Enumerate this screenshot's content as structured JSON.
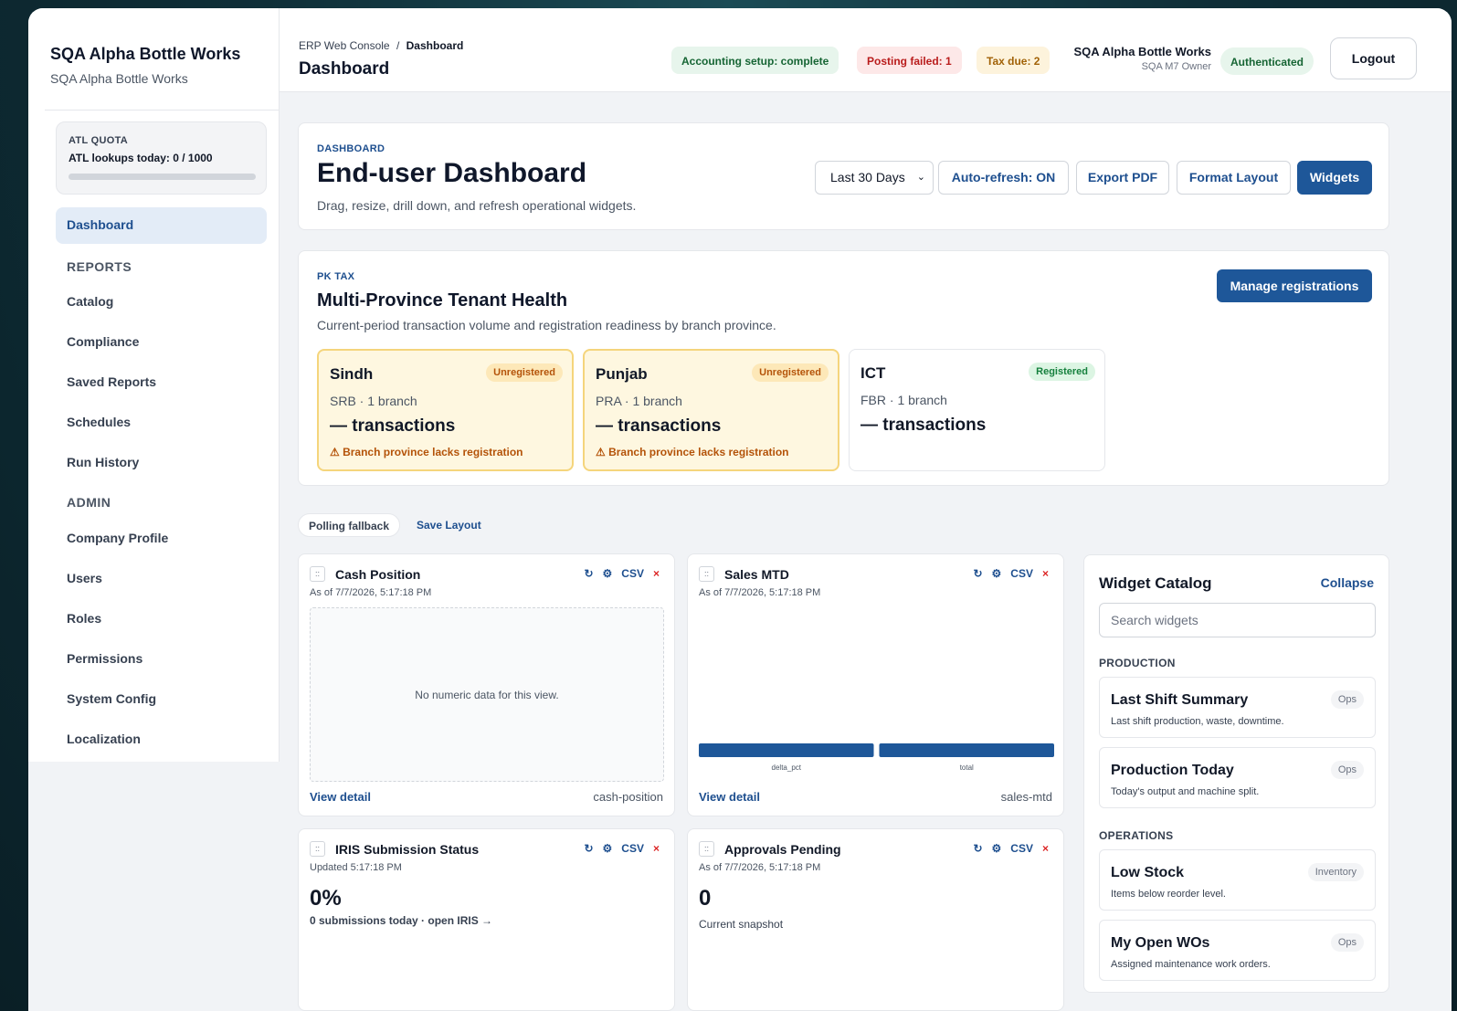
{
  "sidebar": {
    "brand_name": "SQA Alpha Bottle Works",
    "brand_sub": "SQA Alpha Bottle Works",
    "quota_title": "ATL QUOTA",
    "quota_value": "ATL lookups today: 0 / 1000",
    "quota_used": 0,
    "active_item": "Dashboard",
    "reports_heading": "REPORTS",
    "reports": [
      "Catalog",
      "Compliance",
      "Saved Reports",
      "Schedules",
      "Run History"
    ],
    "admin_heading": "ADMIN",
    "admin": [
      "Company Profile",
      "Users",
      "Roles",
      "Permissions",
      "System Config",
      "Localization"
    ]
  },
  "topbar": {
    "crumb_root": "ERP Web Console",
    "crumb_sep": "/",
    "crumb_current": "Dashboard",
    "title": "Dashboard",
    "status_accounting": "Accounting setup: complete",
    "status_posting": "Posting failed: 1",
    "status_tax": "Tax due: 2",
    "user_name": "SQA Alpha Bottle Works",
    "user_role": "SQA M7 Owner",
    "auth": "Authenticated",
    "logout": "Logout"
  },
  "hero": {
    "eyebrow": "DASHBOARD",
    "title": "End-user Dashboard",
    "desc": "Drag, resize, drill down, and refresh operational widgets.",
    "range": "Last 30 Days",
    "auto_refresh": "Auto-refresh: ON",
    "export": "Export PDF",
    "format": "Format Layout",
    "widgets": "Widgets"
  },
  "pktax": {
    "eyebrow": "PK TAX",
    "title": "Multi-Province Tenant Health",
    "desc": "Current-period transaction volume and registration readiness by branch province.",
    "manage": "Manage registrations",
    "provinces": [
      {
        "name": "Sindh",
        "status": "Unregistered",
        "sub": "SRB · 1 branch",
        "tx": "— transactions",
        "warn": "⚠ Branch province lacks registration"
      },
      {
        "name": "Punjab",
        "status": "Unregistered",
        "sub": "PRA · 1 branch",
        "tx": "— transactions",
        "warn": "⚠ Branch province lacks registration"
      },
      {
        "name": "ICT",
        "status": "Registered",
        "sub": "FBR · 1 branch",
        "tx": "— transactions"
      }
    ]
  },
  "layout_bar": {
    "polling": "Polling fallback",
    "save": "Save Layout"
  },
  "widget_actions": {
    "refresh": "↻",
    "settings": "⚙",
    "csv": "CSV",
    "remove": "×",
    "grip": "::"
  },
  "widgets": {
    "cash": {
      "title": "Cash Position",
      "ts": "As of 7/7/2026, 5:17:18 PM",
      "empty": "No numeric data for this view.",
      "detail": "View detail",
      "key": "cash-position"
    },
    "sales": {
      "title": "Sales MTD",
      "ts": "As of 7/7/2026, 5:17:18 PM",
      "detail": "View detail",
      "key": "sales-mtd"
    },
    "iris": {
      "title": "IRIS Submission Status",
      "ts": "Updated 5:17:18 PM",
      "value": "0%",
      "note": "0 submissions today · open IRIS →"
    },
    "approvals": {
      "title": "Approvals Pending",
      "ts": "As of 7/7/2026, 5:17:18 PM",
      "value": "0",
      "note": "Current snapshot"
    }
  },
  "chart_data": {
    "type": "bar",
    "categories": [
      "delta_pct",
      "total"
    ],
    "values": [
      1,
      1
    ]
  },
  "catalog": {
    "title": "Widget Catalog",
    "collapse": "Collapse",
    "search_placeholder": "Search widgets",
    "groups": [
      {
        "name": "PRODUCTION",
        "items": [
          {
            "name": "Last Shift Summary",
            "desc": "Last shift production, waste, downtime.",
            "badge": "Ops"
          },
          {
            "name": "Production Today",
            "desc": "Today's output and machine split.",
            "badge": "Ops"
          }
        ]
      },
      {
        "name": "OPERATIONS",
        "items": [
          {
            "name": "Low Stock",
            "desc": "Items below reorder level.",
            "badge": "Inventory"
          },
          {
            "name": "My Open WOs",
            "desc": "Assigned maintenance work orders.",
            "badge": "Ops"
          }
        ]
      }
    ]
  },
  "colors": {
    "primary": "#1e5799",
    "accent_text": "#1e4f8f",
    "warn_bg": "#fef7e0",
    "danger": "#dc2626"
  }
}
